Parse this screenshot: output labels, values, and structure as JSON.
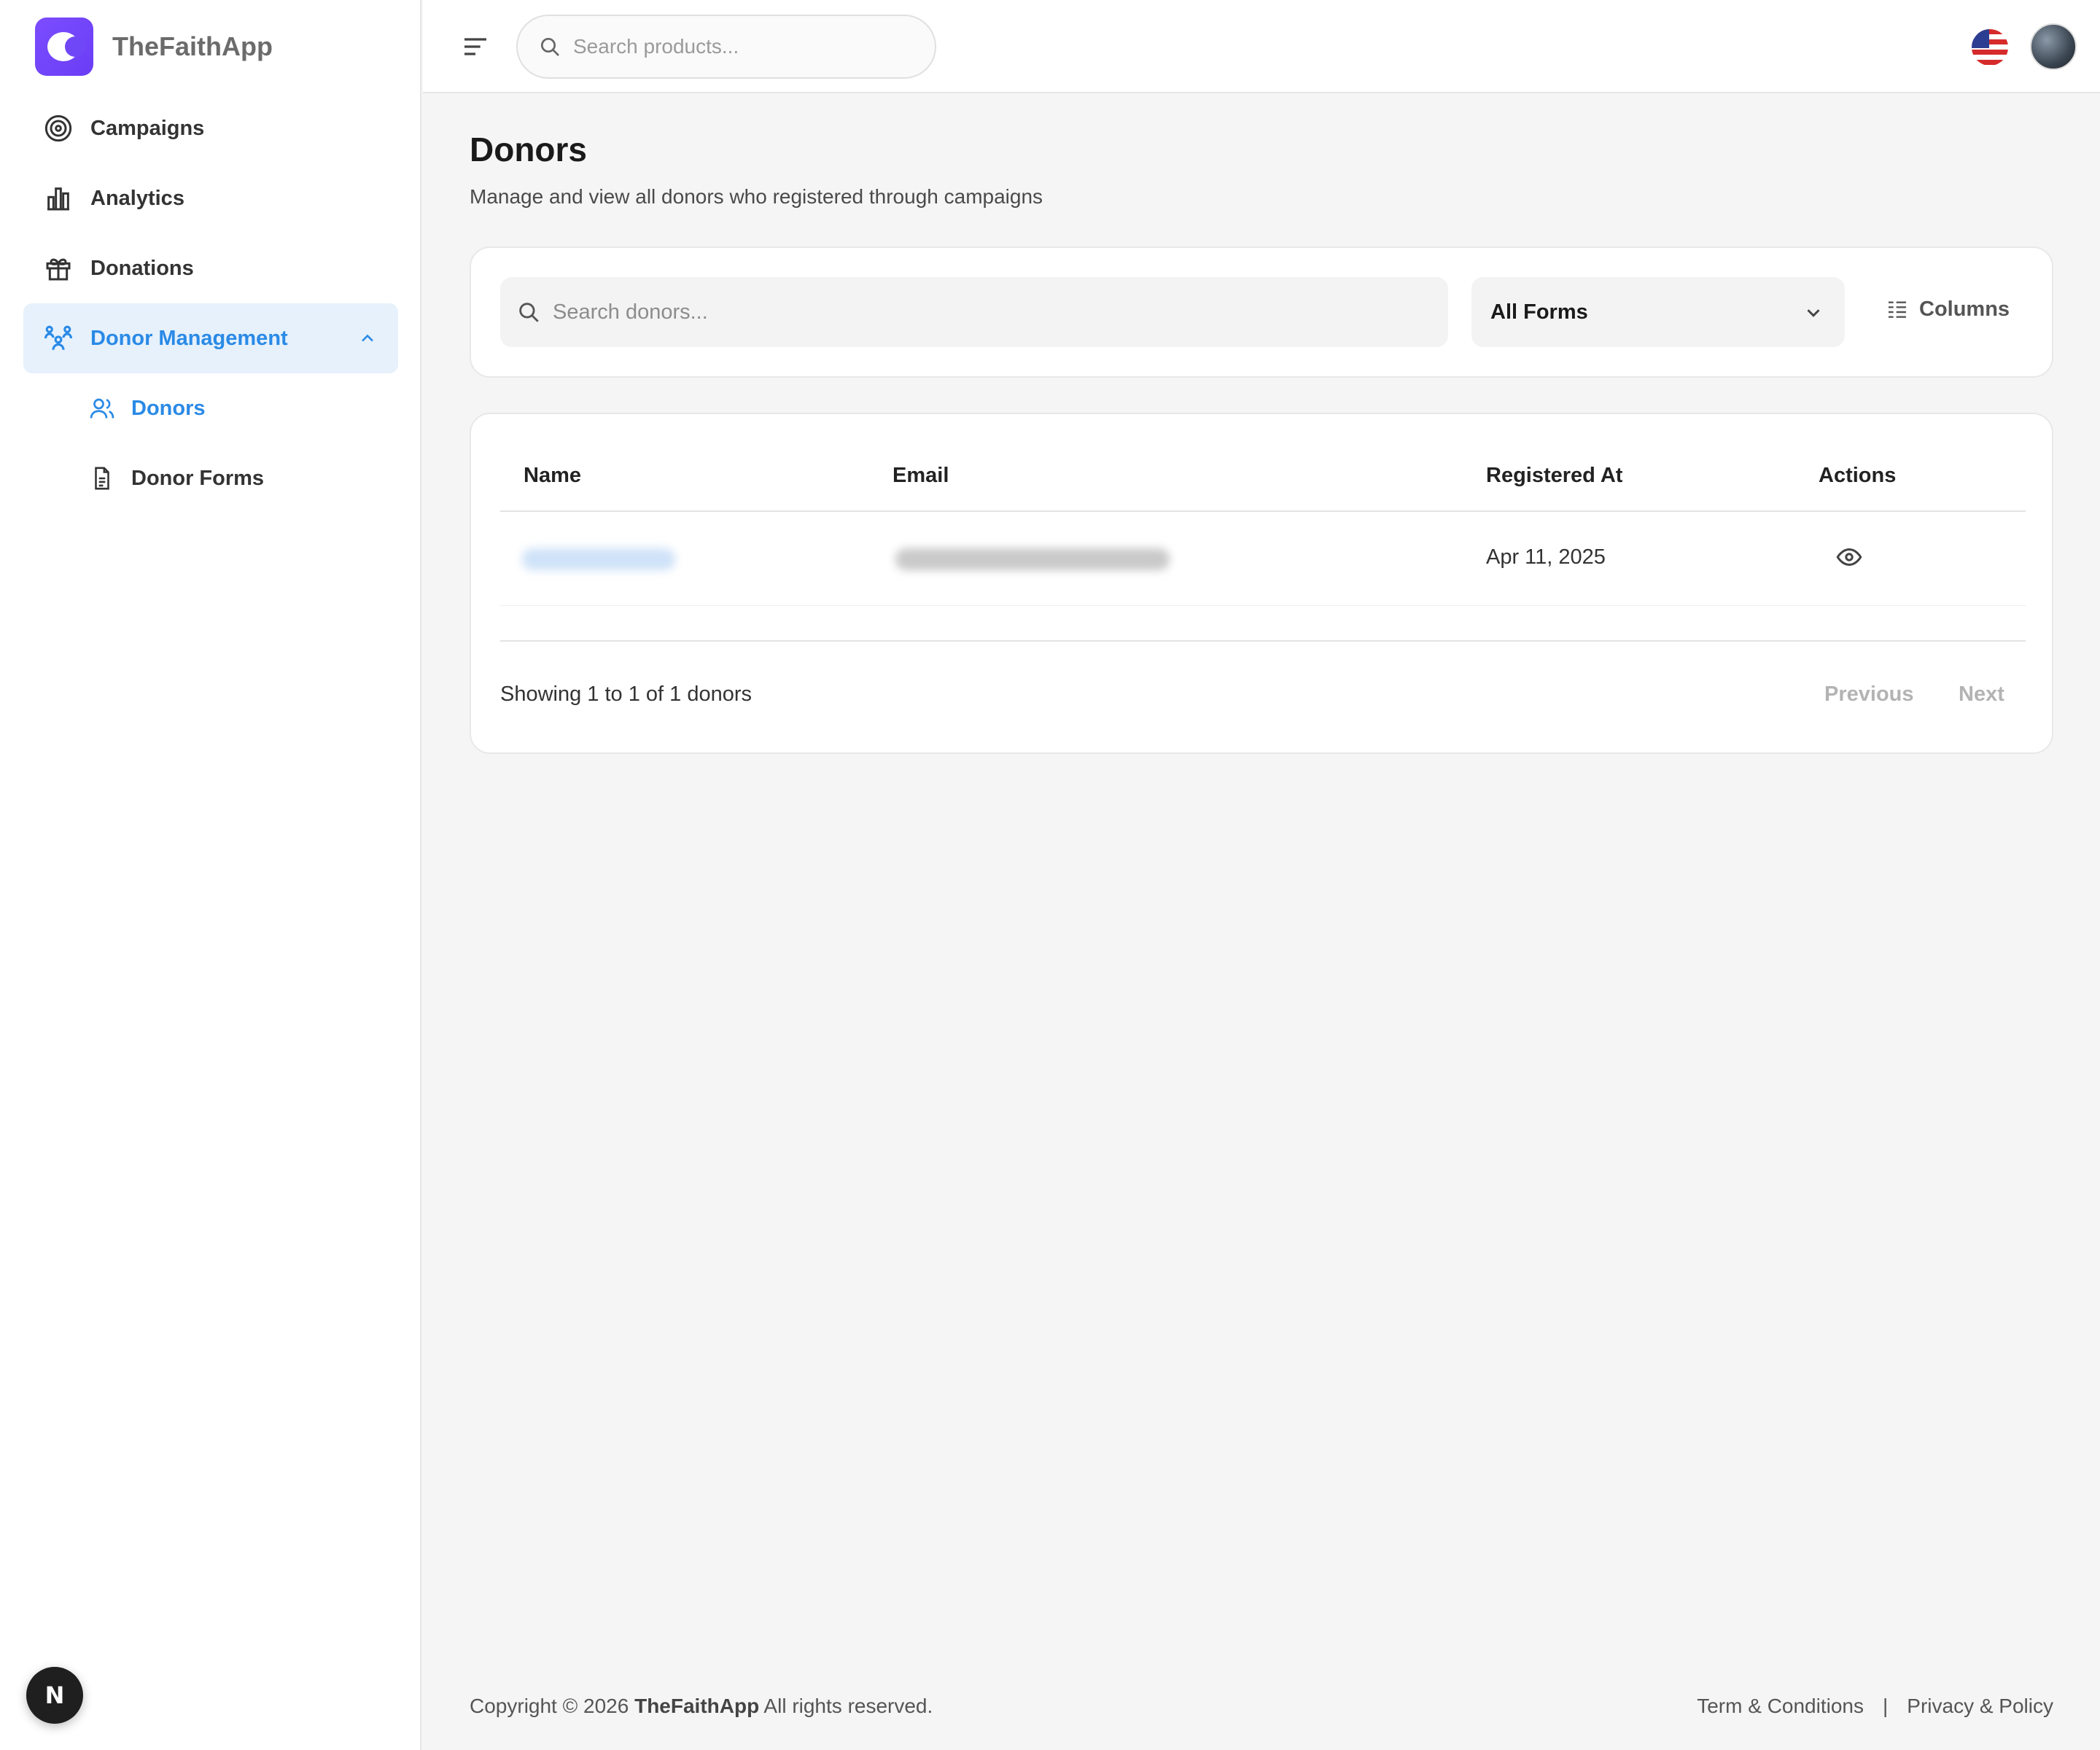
{
  "brand": {
    "name": "TheFaithApp"
  },
  "sidebar": {
    "items": [
      {
        "label": "Campaigns",
        "icon": "target-icon"
      },
      {
        "label": "Analytics",
        "icon": "bar-chart-icon"
      },
      {
        "label": "Donations",
        "icon": "gift-icon"
      },
      {
        "label": "Donor Management",
        "icon": "users-group-icon",
        "expanded": true
      }
    ],
    "sub_items": [
      {
        "label": "Donors",
        "icon": "users-icon",
        "active": true
      },
      {
        "label": "Donor Forms",
        "icon": "document-icon"
      }
    ],
    "dev_badge": "N"
  },
  "topbar": {
    "search_placeholder": "Search products...",
    "language": "flag-us-icon"
  },
  "page": {
    "title": "Donors",
    "subtitle": "Manage and view all donors who registered through campaigns"
  },
  "filters": {
    "search_placeholder": "Search donors...",
    "form_select": "All Forms",
    "columns_label": "Columns"
  },
  "table": {
    "headers": [
      "Name",
      "Email",
      "Registered At",
      "Actions"
    ],
    "rows": [
      {
        "name": "",
        "email": "",
        "registered_at": "Apr 11, 2025",
        "action": "eye-icon"
      }
    ],
    "showing": "Showing 1 to 1 of 1 donors",
    "previous": "Previous",
    "next": "Next"
  },
  "footer": {
    "copyright_prefix": "Copyright © 2026",
    "brand": "TheFaithApp",
    "copyright_suffix": "All rights reserved.",
    "terms": "Term & Conditions",
    "separator": "|",
    "privacy": "Privacy & Policy"
  },
  "colors": {
    "accent": "#2a8ae6",
    "brand": "#7047f6",
    "active_bg": "#e6f1fc"
  }
}
